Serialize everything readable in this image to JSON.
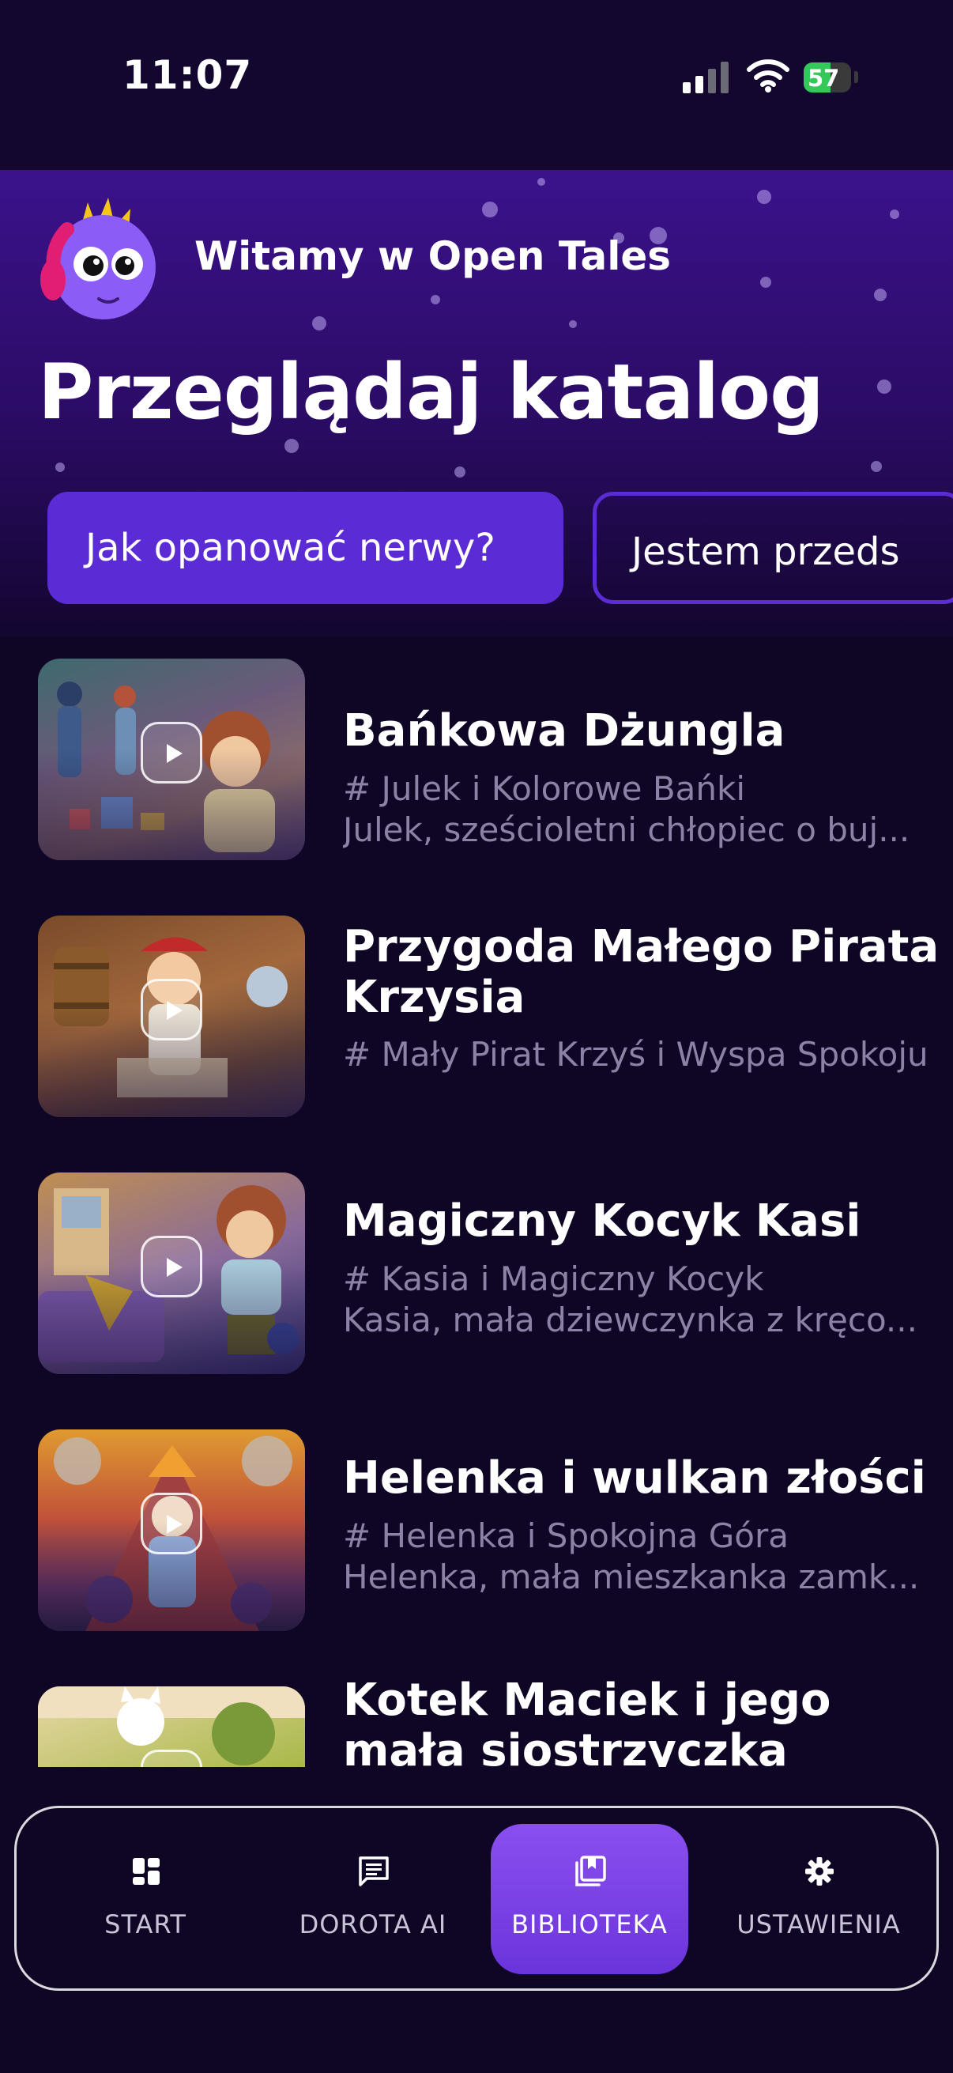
{
  "status_bar": {
    "time": "11:07",
    "battery": "57",
    "battery_level": 0.57,
    "icons": [
      "signal-icon",
      "wifi-icon",
      "battery-icon"
    ]
  },
  "header": {
    "welcome": "Witamy w Open Tales",
    "title": "Przeglądaj katalog"
  },
  "chips": [
    {
      "label": "Jak opanować nerwy?",
      "active": true
    },
    {
      "label": "Jestem przeds",
      "active": false
    }
  ],
  "stories": [
    {
      "title": "Bańkowa Dżungla",
      "series": "# Julek i Kolorowe Bańki",
      "desc": "Julek, sześcioletni chłopiec o buj..."
    },
    {
      "title": "Przygoda Małego Pirata Krzysia",
      "series": "# Mały Pirat Krzyś i Wyspa Spokoju",
      "desc": ""
    },
    {
      "title": "Magiczny Kocyk Kasi",
      "series": "# Kasia i Magiczny Kocyk",
      "desc": "Kasia, mała dziewczynka z kręco..."
    },
    {
      "title": "Helenka i wulkan złości",
      "series": "# Helenka i Spokojna Góra",
      "desc": "Helenka, mała mieszkanka zamk..."
    },
    {
      "title": "Kotek Maciek i jego mała siostrzyczka",
      "series": "",
      "desc": ""
    }
  ],
  "nav": {
    "items": [
      {
        "label": "START",
        "icon": "dashboard-icon"
      },
      {
        "label": "DOROTA AI",
        "icon": "chat-icon"
      },
      {
        "label": "BIBLIOTEKA",
        "icon": "library-icon",
        "active": true
      },
      {
        "label": "USTAWIENIA",
        "icon": "settings-icon"
      }
    ]
  },
  "colors": {
    "accent": "#5b2bd6",
    "nav_active": "#7c45e8",
    "background": "#0f0524"
  }
}
